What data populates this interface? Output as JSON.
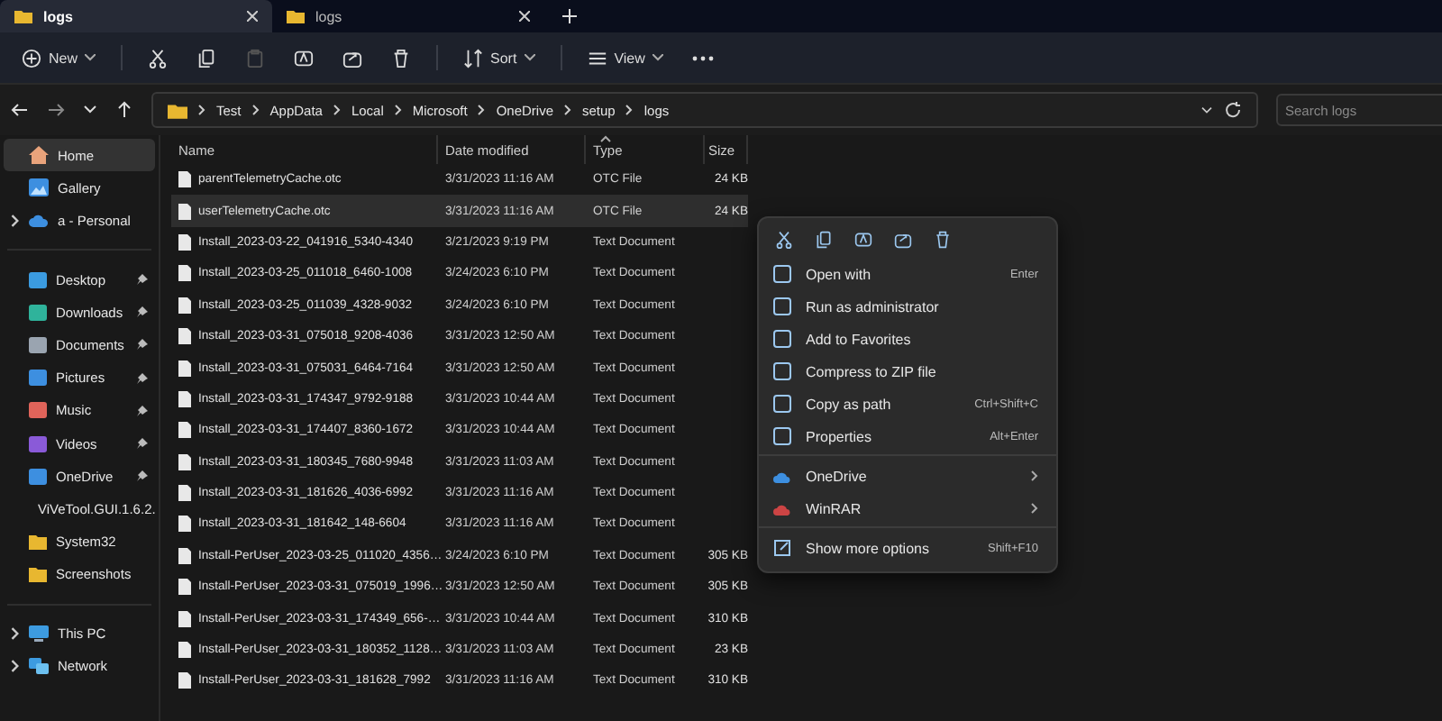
{
  "tabs": [
    {
      "label": "logs",
      "selected": true
    },
    {
      "label": "logs",
      "selected": false
    }
  ],
  "toolbar": [
    {
      "label": "New",
      "disabled": false
    },
    {
      "disabled": false
    },
    {
      "disabled": false
    },
    {
      "disabled": true
    },
    {
      "disabled": false
    },
    {
      "disabled": false
    },
    {
      "disabled": false
    },
    {
      "label": "Sort",
      "disabled": false
    },
    {
      "label": "View",
      "disabled": false
    }
  ],
  "breadcrumb": [
    "Test",
    "AppData",
    "Local",
    "Microsoft",
    "OneDrive",
    "setup",
    "logs"
  ],
  "search": {
    "placeholder": "Search logs"
  },
  "sidebar": {
    "top": [
      {
        "label": "Home",
        "selected": true,
        "expandable": false
      },
      {
        "label": "Gallery",
        "selected": false,
        "expandable": false
      },
      {
        "label": "a - Personal",
        "selected": false,
        "expandable": true
      }
    ],
    "quick": [
      {
        "label": "Desktop",
        "pinned": true,
        "selected": false
      },
      {
        "label": "Downloads",
        "pinned": true,
        "selected": false
      },
      {
        "label": "Documents",
        "pinned": true,
        "selected": false
      },
      {
        "label": "Pictures",
        "pinned": true,
        "selected": false
      },
      {
        "label": "Music",
        "pinned": true,
        "selected": false
      },
      {
        "label": "Videos",
        "pinned": true,
        "selected": false
      },
      {
        "label": "OneDrive",
        "pinned": true,
        "selected": false
      },
      {
        "label": "ViVeTool.GUI.1.6.2.",
        "pinned": false,
        "selected": false
      },
      {
        "label": "System32",
        "pinned": false,
        "selected": false
      },
      {
        "label": "Screenshots",
        "pinned": false,
        "selected": false
      }
    ],
    "bottom": [
      {
        "label": "This PC",
        "selected": false,
        "expandable": true
      },
      {
        "label": "Network",
        "selected": false,
        "expandable": true
      }
    ]
  },
  "table": {
    "columns": [
      {
        "label": "Name",
        "sorted": false
      },
      {
        "label": "Date modified",
        "sorted": false
      },
      {
        "label": "Type",
        "sorted": true
      },
      {
        "label": "Size",
        "sorted": false
      }
    ],
    "rows": [
      {
        "name": "parentTelemetryCache.otc",
        "date": "3/31/2023 11:16 AM",
        "type": "OTC File",
        "size": "24 KB",
        "selected": false
      },
      {
        "name": "userTelemetryCache.otc",
        "date": "3/31/2023 11:16 AM",
        "type": "OTC File",
        "size": "24 KB",
        "selected": true
      },
      {
        "name": "Install_2023-03-22_041916_5340-4340",
        "date": "3/21/2023 9:19 PM",
        "type": "Text Document",
        "selected": false
      },
      {
        "name": "Install_2023-03-25_011018_6460-1008",
        "date": "3/24/2023 6:10 PM",
        "type": "Text Document",
        "selected": false
      },
      {
        "name": "Install_2023-03-25_011039_4328-9032",
        "date": "3/24/2023 6:10 PM",
        "type": "Text Document",
        "selected": false
      },
      {
        "name": "Install_2023-03-31_075018_9208-4036",
        "date": "3/31/2023 12:50 AM",
        "type": "Text Document",
        "selected": false
      },
      {
        "name": "Install_2023-03-31_075031_6464-7164",
        "date": "3/31/2023 12:50 AM",
        "type": "Text Document",
        "selected": false
      },
      {
        "name": "Install_2023-03-31_174347_9792-9188",
        "date": "3/31/2023 10:44 AM",
        "type": "Text Document",
        "selected": false
      },
      {
        "name": "Install_2023-03-31_174407_8360-1672",
        "date": "3/31/2023 10:44 AM",
        "type": "Text Document",
        "selected": false
      },
      {
        "name": "Install_2023-03-31_180345_7680-9948",
        "date": "3/31/2023 11:03 AM",
        "type": "Text Document",
        "selected": false
      },
      {
        "name": "Install_2023-03-31_181626_4036-6992",
        "date": "3/31/2023 11:16 AM",
        "type": "Text Document",
        "selected": false
      },
      {
        "name": "Install_2023-03-31_181642_148-6604",
        "date": "3/31/2023 11:16 AM",
        "type": "Text Document",
        "selected": false
      },
      {
        "name": "Install-PerUser_2023-03-25_011020_4356…",
        "date": "3/24/2023 6:10 PM",
        "type": "Text Document",
        "size": "305 KB",
        "selected": false
      },
      {
        "name": "Install-PerUser_2023-03-31_075019_1996…",
        "date": "3/31/2023 12:50 AM",
        "type": "Text Document",
        "size": "305 KB",
        "selected": false
      },
      {
        "name": "Install-PerUser_2023-03-31_174349_656-…",
        "date": "3/31/2023 10:44 AM",
        "type": "Text Document",
        "size": "310 KB",
        "selected": false
      },
      {
        "name": "Install-PerUser_2023-03-31_180352_1128…",
        "date": "3/31/2023 11:03 AM",
        "type": "Text Document",
        "size": "23 KB",
        "selected": false
      },
      {
        "name": "Install-PerUser_2023-03-31_181628_7992",
        "date": "3/31/2023 11:16 AM",
        "type": "Text Document",
        "size": "310 KB",
        "selected": false
      }
    ]
  },
  "context_menu": {
    "groups": [
      [
        {
          "label": "Open with",
          "shortcut": "Enter",
          "submenu": false
        },
        {
          "label": "Run as administrator",
          "submenu": false
        },
        {
          "label": "Add to Favorites",
          "submenu": false
        },
        {
          "label": "Compress to ZIP file",
          "submenu": false
        },
        {
          "label": "Copy as path",
          "shortcut": "Ctrl+Shift+C",
          "submenu": false
        },
        {
          "label": "Properties",
          "shortcut": "Alt+Enter",
          "submenu": false
        }
      ],
      [
        {
          "label": "OneDrive",
          "submenu": true
        },
        {
          "label": "WinRAR",
          "submenu": true
        }
      ],
      [
        {
          "label": "Show more options",
          "shortcut": "Shift+F10",
          "submenu": false
        }
      ]
    ]
  }
}
